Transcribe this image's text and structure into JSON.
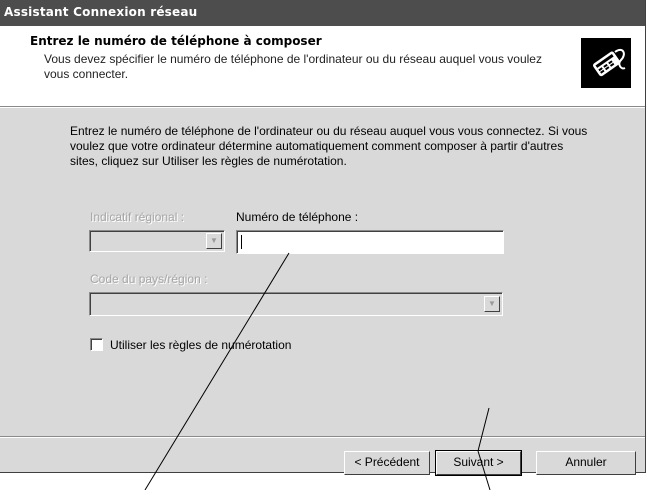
{
  "window": {
    "title": "Assistant Connexion réseau"
  },
  "header": {
    "title": "Entrez le numéro de téléphone à composer",
    "subtitle": "Vous devez spécifier le numéro de téléphone de l'ordinateur ou du réseau auquel vous voulez vous connecter.",
    "icon": "phone-handset-icon"
  },
  "body": {
    "intro": "Entrez le numéro de téléphone de l'ordinateur ou du réseau auquel vous vous connectez. Si vous voulez que votre ordinateur détermine automatiquement comment composer à partir d'autres sites, cliquez sur Utiliser les règles de numérotation.",
    "area_code_label": "Indicatif régional :",
    "area_code_value": "",
    "phone_label": "Numéro de téléphone :",
    "phone_value": "",
    "country_label": "Code du pays/région :",
    "country_value": "",
    "dialing_rules_label": "Utiliser les règles de numérotation",
    "dialing_rules_checked": false
  },
  "buttons": {
    "back": "< Précédent",
    "next": "Suivant >",
    "cancel": "Annuler"
  },
  "colors": {
    "titlebar": "#4d4d4d",
    "dialog": "#d9d9d9",
    "header": "#ffffff"
  }
}
